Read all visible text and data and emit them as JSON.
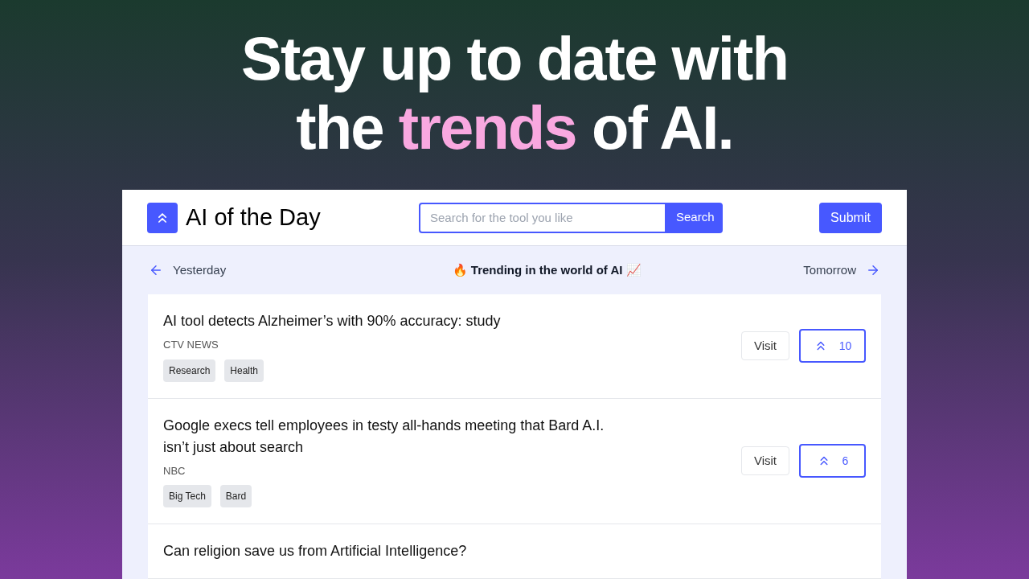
{
  "headline": {
    "lines": [
      [
        {
          "text": "Stay up to date with",
          "highlight": false
        }
      ],
      [
        {
          "text": "the ",
          "highlight": false
        },
        {
          "text": "trends",
          "highlight": true
        },
        {
          "text": " of AI.",
          "highlight": false
        }
      ]
    ]
  },
  "header": {
    "logo_text": "AI of the Day",
    "search": {
      "placeholder": "Search for the tool you like",
      "button": "Search"
    },
    "submit": "Submit"
  },
  "nav": {
    "previous": "Yesterday",
    "title": "🔥 Trending in the world of AI 📈",
    "next": "Tomorrow"
  },
  "articles": [
    {
      "title": "AI tool detects Alzheimer’s with 90% accuracy: study",
      "source": "CTV NEWS",
      "tags": [
        "Research",
        "Health"
      ],
      "visit": "Visit",
      "votes": "10"
    },
    {
      "title": "Google execs tell employees in testy all-hands meeting that Bard A.I. isn’t just about search",
      "source": "NBC",
      "tags": [
        "Big Tech",
        "Bard"
      ],
      "visit": "Visit",
      "votes": "6"
    },
    {
      "title": "Can religion save us from Artificial Intelligence?"
    }
  ]
}
